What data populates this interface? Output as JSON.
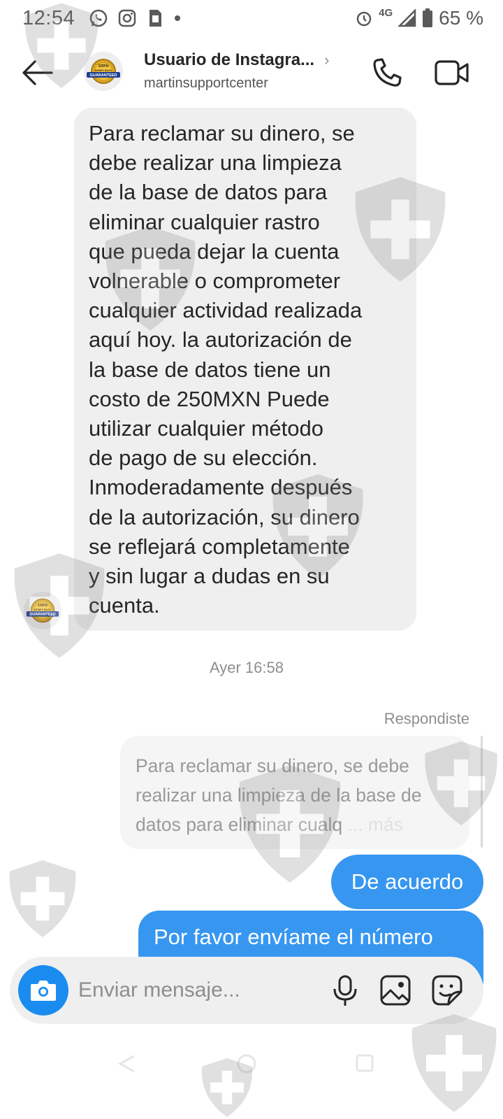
{
  "status_bar": {
    "time": "12:54",
    "network": "4G",
    "battery": "65 %",
    "icons": [
      "whatsapp-icon",
      "instagram-icon",
      "sim-icon",
      "dot-icon",
      "alarm-icon",
      "signal-icon",
      "battery-icon"
    ]
  },
  "header": {
    "name": "Usuario de Instagra...",
    "chevron": "›",
    "username": "martinsupportcenter",
    "avatar_badge_lines": [
      "100%",
      "MONEY BACK",
      "GUARANTEED"
    ]
  },
  "messages": {
    "incoming_text": "Para reclamar su dinero, se\ndebe realizar una limpieza\nde la base de datos para\neliminar cualquier rastro\nque pueda dejar la cuenta\nvolnerable o comprometer\ncualquier actividad realizada\naquí hoy. la autorización de\nla base de datos tiene un\ncosto de 250MXN Puede\nutilizar cualquier método\nde pago de su elección.\nInmoderadamente después\nde la autorización, su dinero\nse reflejará completamente\ny sin lugar a dudas en su\ncuenta.",
    "timestamp": "Ayer 16:58",
    "replied_label": "Respondiste",
    "quoted_text": "Para reclamar su dinero, se debe realizar una limpieza de la base de datos para eliminar cualq",
    "quoted_more": "... más",
    "outgoing_1": "De acuerdo",
    "outgoing_2": "Por favor envíame el número"
  },
  "composer": {
    "placeholder": "Enviar mensaje..."
  },
  "colors": {
    "accent_blue": "#3797f0",
    "camera_blue": "#1a8cf0",
    "incoming_bubble": "#efefef",
    "quote_bubble": "#f5f5f5"
  }
}
